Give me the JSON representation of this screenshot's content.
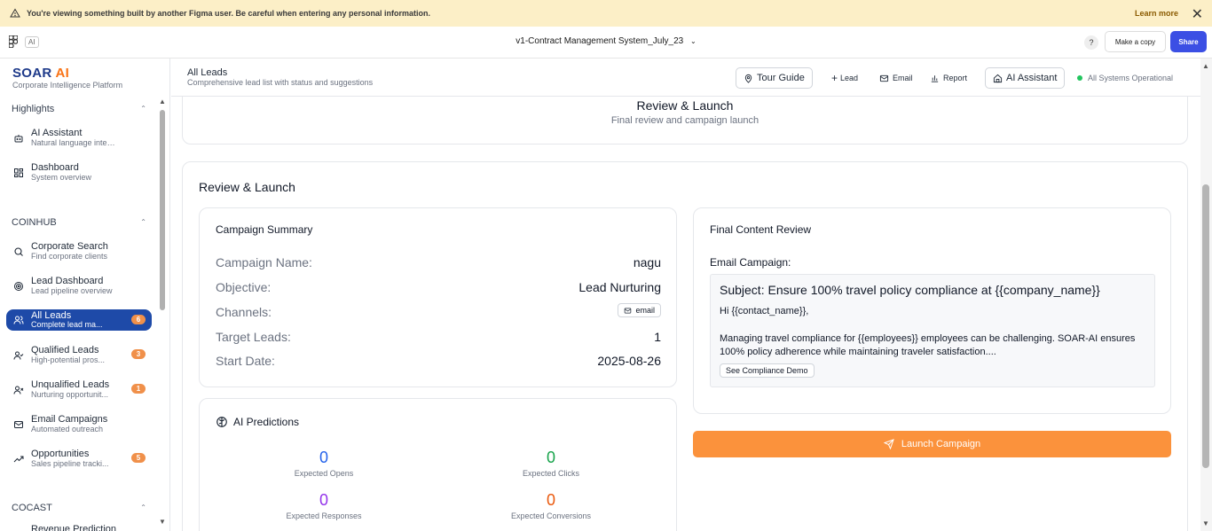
{
  "banner": {
    "message": "You're viewing something built by another Figma user. Be careful when entering any personal information.",
    "learn_more": "Learn more",
    "close": "✕"
  },
  "figma": {
    "ai_chip": "AI",
    "doc_title": "v1-Contract Management System_July_23",
    "help": "?",
    "make_copy": "Make a copy",
    "share": "Share"
  },
  "brand": {
    "name_main": "SOAR",
    "name_ai": "AI",
    "tagline": "Corporate Intelligence Platform"
  },
  "sidebar": {
    "sections": [
      {
        "title": "Highlights"
      },
      {
        "title": "COINHUB"
      },
      {
        "title": "COCAST"
      }
    ],
    "items": [
      {
        "label": "AI Assistant",
        "sub": "Natural language interface",
        "icon": "bot-icon"
      },
      {
        "label": "Dashboard",
        "sub": "System overview",
        "icon": "dashboard-icon"
      },
      {
        "label": "Corporate Search",
        "sub": "Find corporate clients",
        "icon": "search-icon"
      },
      {
        "label": "Lead Dashboard",
        "sub": "Lead pipeline overview",
        "icon": "target-icon"
      },
      {
        "label": "All Leads",
        "sub": "Complete lead ma...",
        "icon": "users-icon",
        "badge": "6"
      },
      {
        "label": "Qualified Leads",
        "sub": "High-potential pros...",
        "icon": "user-check-icon",
        "badge": "3"
      },
      {
        "label": "Unqualified Leads",
        "sub": "Nurturing opportunit...",
        "icon": "user-x-icon",
        "badge": "1"
      },
      {
        "label": "Email Campaigns",
        "sub": "Automated outreach",
        "icon": "mail-icon"
      },
      {
        "label": "Opportunities",
        "sub": "Sales pipeline tracki...",
        "icon": "trending-up-icon",
        "badge": "5"
      },
      {
        "label": "Revenue Prediction",
        "sub": "",
        "icon": "chart-icon"
      }
    ]
  },
  "header": {
    "title": "All Leads",
    "description": "Comprehensive lead list with status and suggestions",
    "tour_guide": "Tour Guide",
    "lead": "Lead",
    "email": "Email",
    "report": "Report",
    "ai_assistant": "AI Assistant",
    "status": "All Systems Operational"
  },
  "step": {
    "title": "Review & Launch",
    "subtitle": "Final review and campaign launch"
  },
  "review": {
    "heading": "Review & Launch",
    "summary": {
      "title": "Campaign Summary",
      "rows": [
        {
          "k": "Campaign Name:",
          "v": "nagu"
        },
        {
          "k": "Objective:",
          "v": "Lead Nurturing"
        },
        {
          "k": "Channels:",
          "v": "email"
        },
        {
          "k": "Target Leads:",
          "v": "1"
        },
        {
          "k": "Start Date:",
          "v": "2025-08-26"
        }
      ]
    },
    "predictions": {
      "title": "AI Predictions",
      "items": [
        {
          "value": "0",
          "label": "Expected Opens",
          "color": "#2563eb"
        },
        {
          "value": "0",
          "label": "Expected Clicks",
          "color": "#16a34a"
        },
        {
          "value": "0",
          "label": "Expected Responses",
          "color": "#9333ea"
        },
        {
          "value": "0",
          "label": "Expected Conversions",
          "color": "#ea580c"
        }
      ]
    },
    "content": {
      "title": "Final Content Review",
      "email_label": "Email Campaign:",
      "subject": "Subject: Ensure 100% travel policy compliance at {{company_name}}",
      "greeting": "Hi {{contact_name}},",
      "body": "Managing travel compliance for {{employees}} employees can be challenging. SOAR-AI ensures 100% policy adherence while maintaining traveler satisfaction....",
      "cta": "See Compliance Demo"
    },
    "launch": "Launch Campaign"
  },
  "colors": {
    "accent": "#1e4aa8",
    "brand_ai": "#f97316",
    "launch": "#fb923c",
    "badge": "#f0904a",
    "status_ok": "#22c55e"
  }
}
